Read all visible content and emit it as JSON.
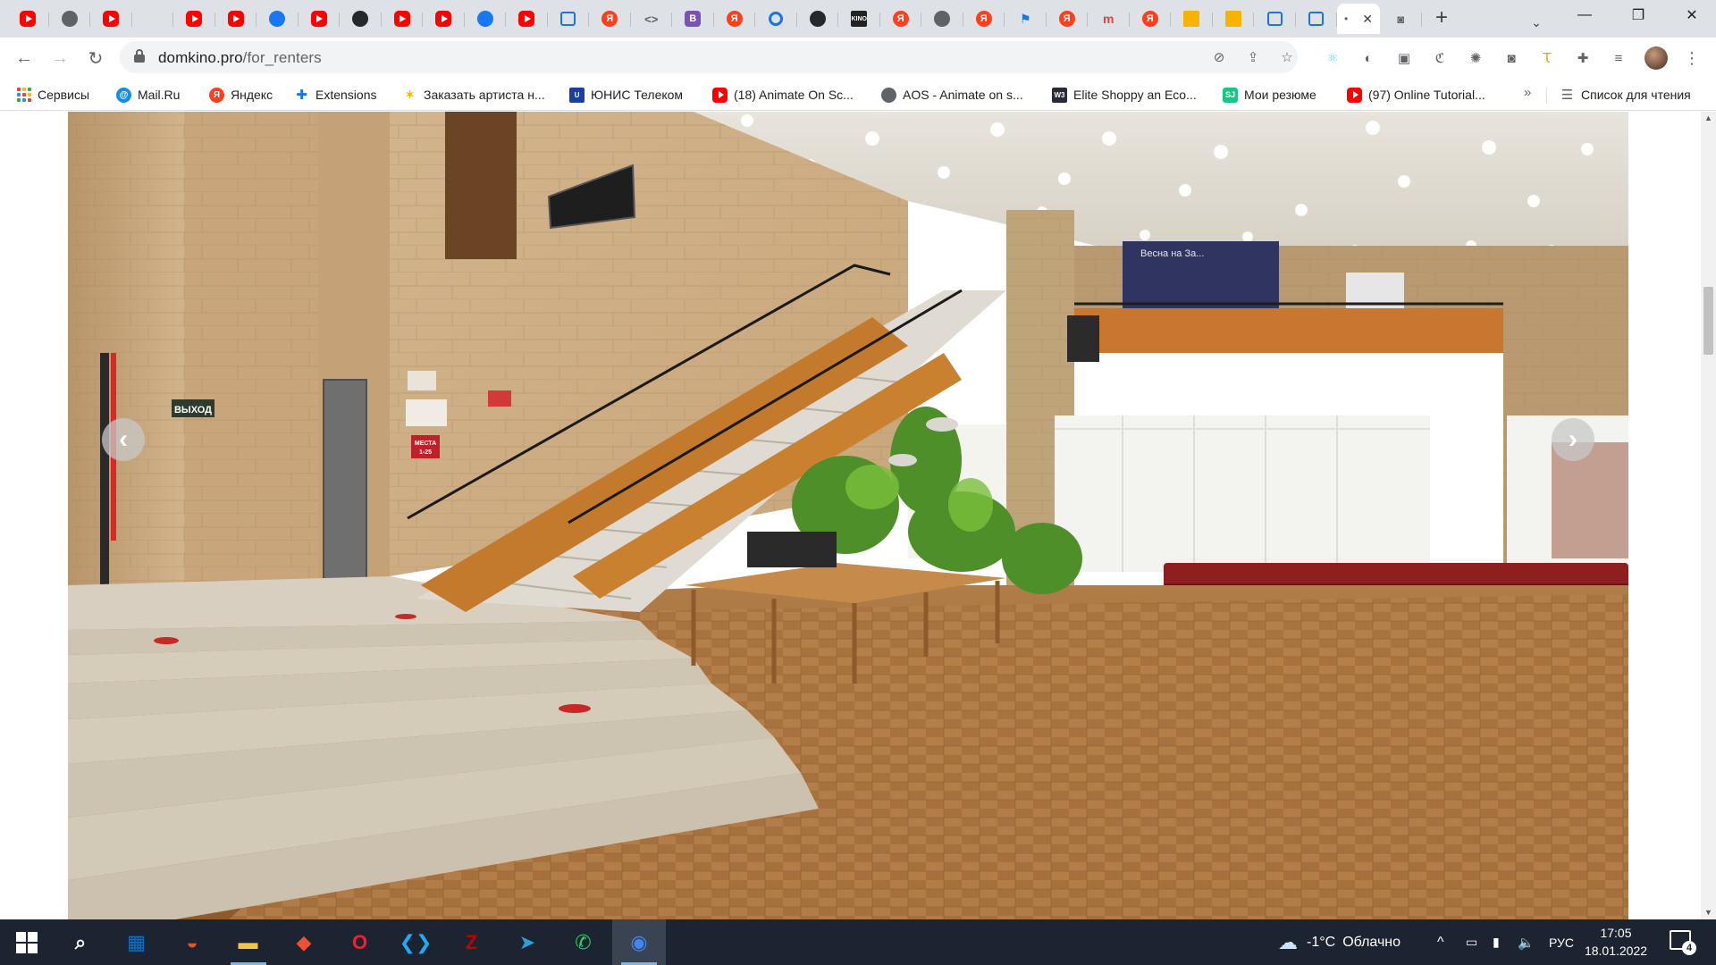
{
  "browser": {
    "tabs": [
      {
        "icon": "youtube-icon"
      },
      {
        "icon": "globe-icon"
      },
      {
        "icon": "youtube-icon"
      },
      {
        "icon": "dots-icon"
      },
      {
        "icon": "youtube-icon"
      },
      {
        "icon": "youtube-icon"
      },
      {
        "icon": "facebook-icon"
      },
      {
        "icon": "youtube-icon"
      },
      {
        "icon": "github-icon"
      },
      {
        "icon": "youtube-icon"
      },
      {
        "icon": "youtube-icon"
      },
      {
        "icon": "facebook-icon"
      },
      {
        "icon": "youtube-icon"
      },
      {
        "icon": "pocket-icon"
      },
      {
        "icon": "yandex-icon",
        "glyph": "Я"
      },
      {
        "icon": "code-icon",
        "glyph": "<>"
      },
      {
        "icon": "bootstrap-icon",
        "glyph": "B"
      },
      {
        "icon": "yandex-icon",
        "glyph": "Я"
      },
      {
        "icon": "sync-icon"
      },
      {
        "icon": "github-icon"
      },
      {
        "icon": "photo-icon",
        "glyph": "KINO"
      },
      {
        "icon": "yandex-icon",
        "glyph": "Я"
      },
      {
        "icon": "globe-icon"
      },
      {
        "icon": "yandex-icon",
        "glyph": "Я"
      },
      {
        "icon": "flag-icon",
        "glyph": "⚑"
      },
      {
        "icon": "yandex-icon",
        "glyph": "Я"
      },
      {
        "icon": "gem-icon",
        "glyph": "m"
      },
      {
        "icon": "yandex-icon",
        "glyph": "Я"
      },
      {
        "icon": "slides-icon"
      },
      {
        "icon": "slides-icon"
      },
      {
        "icon": "pocket-icon"
      },
      {
        "icon": "pocket-icon"
      }
    ],
    "active_tab": {
      "title": "•",
      "close": "✕"
    },
    "camera_tab_icon": "camera-icon",
    "new_tab": "+",
    "window_controls": {
      "tab_search": "⌄",
      "minimize": "—",
      "maximize": "❐",
      "close": "✕"
    },
    "nav": {
      "back": "←",
      "forward": "→",
      "reload": "↻"
    },
    "omnibox": {
      "host": "domkino.pro",
      "path": "/for_renters"
    },
    "omnibox_icons": [
      "eye-off-icon",
      "share-icon",
      "star-icon"
    ],
    "extensions": [
      "react-icon",
      "extension-circle-icon",
      "image-icon",
      "css-icon",
      "pixel-icon",
      "camera-icon",
      "translate-icon",
      "puzzle-icon",
      "playlist-icon"
    ],
    "menu": "⋮"
  },
  "bookmarks": [
    {
      "label": "Сервисы",
      "icon": "apps-icon"
    },
    {
      "label": "Mail.Ru",
      "icon": "mailru-icon",
      "glyph": "@"
    },
    {
      "label": "Яндекс",
      "icon": "yandex-icon",
      "glyph": "Я"
    },
    {
      "label": "Extensions",
      "icon": "puzzle-icon",
      "glyph": "✚"
    },
    {
      "label": "Заказать артиста н...",
      "icon": "star-icon",
      "glyph": "✶"
    },
    {
      "label": "ЮНИС Телеком",
      "icon": "unis-icon",
      "glyph": "U"
    },
    {
      "label": "(18) Animate On Sc...",
      "icon": "youtube-icon"
    },
    {
      "label": "AOS - Animate on s...",
      "icon": "globe-icon"
    },
    {
      "label": "Elite Shoppy an Eco...",
      "icon": "w3-icon",
      "glyph": "W3"
    },
    {
      "label": "Мои резюме",
      "icon": "sj-icon",
      "glyph": "SJ"
    },
    {
      "label": "(97) Online Tutorial...",
      "icon": "youtube-icon"
    }
  ],
  "bookmarks_more": "»",
  "reading_list": {
    "label": "Список для чтения",
    "glyph": "☰"
  },
  "page": {
    "slider": {
      "prev": "‹",
      "next": "›"
    },
    "signs": {
      "exit": "ВЫХОД",
      "places": "МЕСТА",
      "places_range": "1-25",
      "poster": "Весна на За..."
    }
  },
  "scrollbar": {
    "up": "▲",
    "down": "▼"
  },
  "taskbar": {
    "apps": [
      {
        "name": "search-icon",
        "glyph": "⌕"
      },
      {
        "name": "store-icon",
        "glyph": "▦"
      },
      {
        "name": "ubuntu-icon",
        "glyph": "◒"
      },
      {
        "name": "file-explorer-icon",
        "glyph": "▬"
      },
      {
        "name": "git-icon",
        "glyph": "◆"
      },
      {
        "name": "opera-icon",
        "glyph": "O"
      },
      {
        "name": "vscode-icon",
        "glyph": "❮❯"
      },
      {
        "name": "filezilla-icon",
        "glyph": "Z"
      },
      {
        "name": "telegram-icon",
        "glyph": "➤"
      },
      {
        "name": "whatsapp-icon",
        "glyph": "✆"
      },
      {
        "name": "chrome-icon",
        "glyph": "◉"
      }
    ],
    "weather": {
      "temp": "-1°C",
      "condition": "Облачно"
    },
    "tray": {
      "chevron": "^",
      "language": "РУС"
    },
    "clock": {
      "time": "17:05",
      "date": "18.01.2022"
    },
    "notifications": "4"
  },
  "colors": {
    "tabstrip": "#dee1e6",
    "taskbar": "#1c2431",
    "accent": "#1a73e8"
  }
}
